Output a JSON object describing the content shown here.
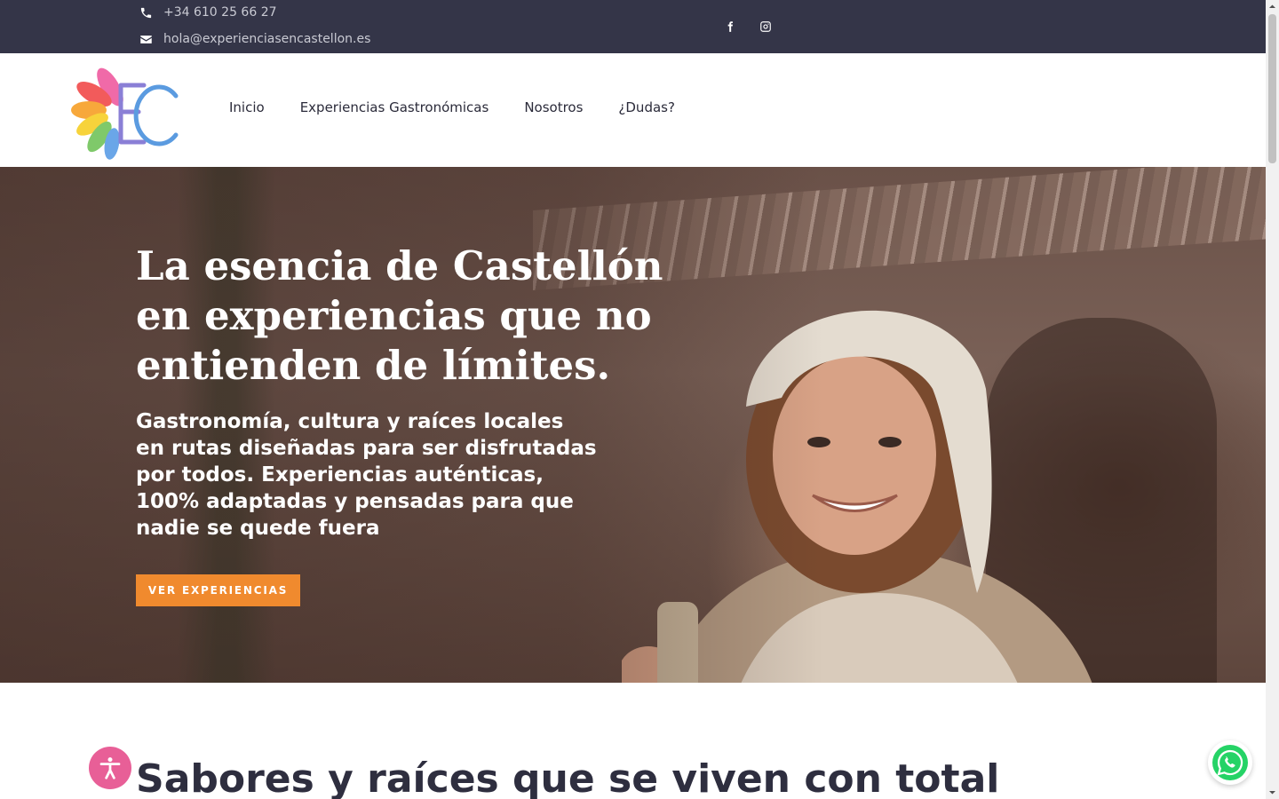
{
  "topbar": {
    "phone": "+34 610 25 66 27",
    "email": "hola@experienciasencastellon.es",
    "phone_icon": "phone-icon",
    "email_icon": "envelope-icon",
    "social": [
      "facebook-icon",
      "instagram-icon"
    ]
  },
  "header": {
    "logo_alt": "EC",
    "nav": [
      "Inicio",
      "Experiencias Gastronómicas",
      "Nosotros",
      "¿Dudas?"
    ]
  },
  "hero": {
    "title": "La esencia de Castellón en experiencias que no entienden de límites.",
    "subtitle": "Gastronomía, cultura y raíces locales en rutas diseñadas para ser disfrutadas por todos. Experiencias auténticas, 100% adaptadas y pensadas para que nadie se quede fuera",
    "cta": "VER EXPERIENCIAS"
  },
  "section": {
    "title": "Sabores y raíces que se viven con total"
  },
  "widgets": {
    "accessibility_icon": "accessibility-icon",
    "whatsapp_icon": "whatsapp-icon"
  },
  "colors": {
    "topbar_bg": "#343548",
    "accent": "#f08a2e",
    "accessibility": "#e85f97",
    "whatsapp": "#25d366"
  }
}
